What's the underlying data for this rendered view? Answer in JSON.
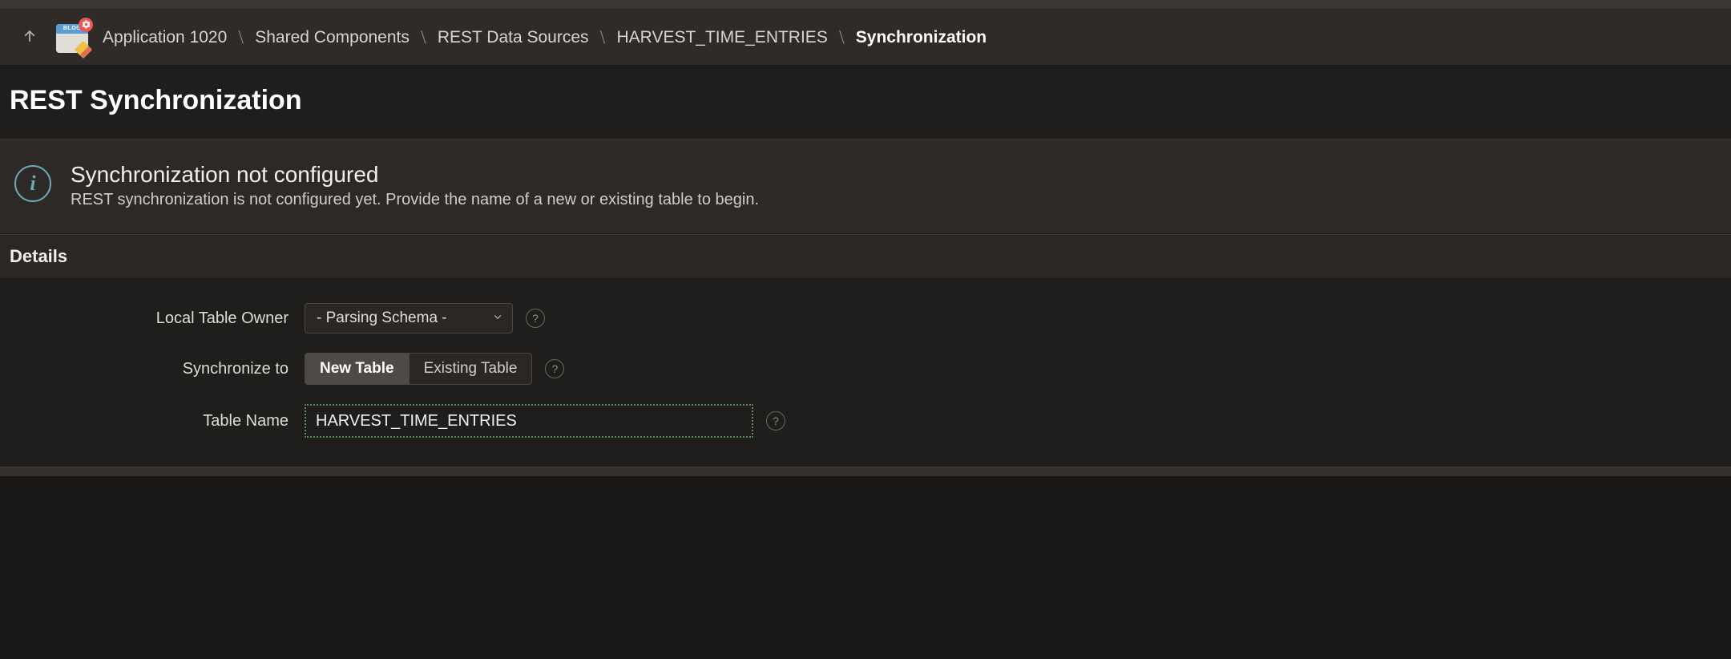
{
  "breadcrumb": {
    "items": [
      "Application 1020",
      "Shared Components",
      "REST Data Sources",
      "HARVEST_TIME_ENTRIES"
    ],
    "current": "Synchronization"
  },
  "page": {
    "title": "REST Synchronization"
  },
  "notice": {
    "title": "Synchronization not configured",
    "desc": "REST synchronization is not configured yet. Provide the name of a new or existing table to begin."
  },
  "section": {
    "title": "Details"
  },
  "form": {
    "owner_label": "Local Table Owner",
    "owner_value": "- Parsing Schema -",
    "sync_to_label": "Synchronize to",
    "sync_to_new": "New Table",
    "sync_to_existing": "Existing Table",
    "table_name_label": "Table Name",
    "table_name_value": "HARVEST_TIME_ENTRIES"
  },
  "icons": {
    "app_badge_text": "BLOG"
  }
}
